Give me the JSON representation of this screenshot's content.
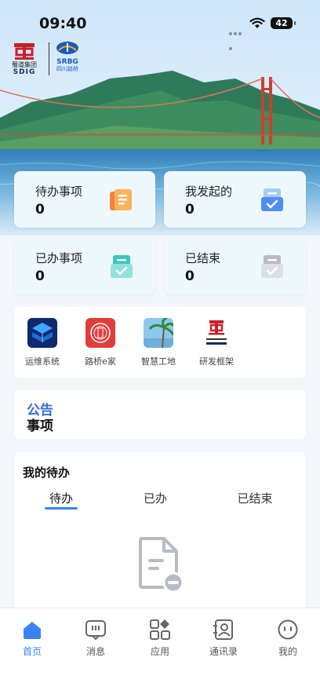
{
  "status_bar": {
    "time": "09:40",
    "battery": "42"
  },
  "brand": {
    "left_logo_cn": "蜀道集团",
    "left_logo_en": "SDIG",
    "right_logo_en": "SRBG",
    "right_logo_cn": "四川路桥"
  },
  "stats": [
    {
      "label": "待办事项",
      "value": "0"
    },
    {
      "label": "我发起的",
      "value": "0"
    },
    {
      "label": "已办事项",
      "value": "0"
    },
    {
      "label": "已结束",
      "value": "0"
    }
  ],
  "apps": [
    {
      "name": "运维系统"
    },
    {
      "name": "路桥e家"
    },
    {
      "name": "智慧工地"
    },
    {
      "name": "研发框架"
    }
  ],
  "notice": {
    "line1": "公告",
    "line2": "事项"
  },
  "todo": {
    "title": "我的待办",
    "tabs": [
      "待办",
      "已办",
      "已结束"
    ]
  },
  "nav": [
    {
      "label": "首页"
    },
    {
      "label": "消息"
    },
    {
      "label": "应用"
    },
    {
      "label": "通讯录"
    },
    {
      "label": "我的"
    }
  ],
  "colors": {
    "accent": "#3b82f6",
    "notice_blue": "#2e6fd6",
    "card_bg": "#eef8fc"
  }
}
